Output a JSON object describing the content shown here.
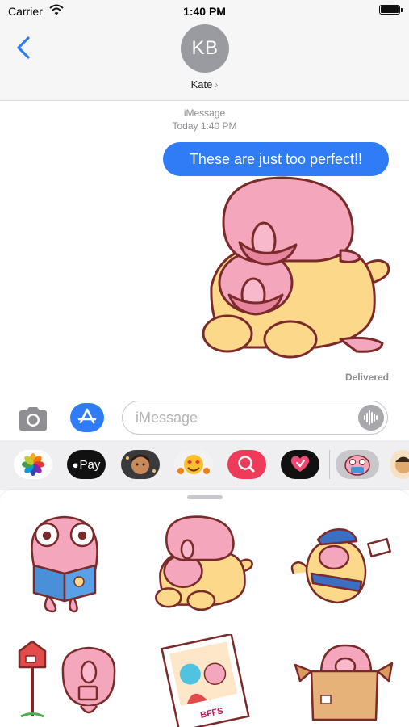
{
  "status_bar": {
    "carrier": "Carrier",
    "time": "1:40 PM"
  },
  "header": {
    "avatar_initials": "KB",
    "contact_name": "Kate",
    "chevron": "›"
  },
  "conversation": {
    "service": "iMessage",
    "timestamp": "Today 1:40 PM",
    "message": "These are just too perfect!!",
    "delivered": "Delivered",
    "sticker": "blobfish-on-cat-sticker"
  },
  "compose": {
    "placeholder": "iMessage"
  },
  "app_strip": [
    {
      "name": "photos-app-icon"
    },
    {
      "name": "apple-pay-app-icon",
      "label": "Pay"
    },
    {
      "name": "memoji-app-icon"
    },
    {
      "name": "emoji-stickers-app-icon"
    },
    {
      "name": "search-images-app-icon"
    },
    {
      "name": "digital-touch-app-icon"
    },
    {
      "name": "blobfish-sticker-app-icon"
    },
    {
      "name": "avatar-app-icon"
    }
  ],
  "stickers": [
    "blobfish-reading-book-sticker",
    "blobfish-on-cat-sticker",
    "blobfish-mail-carrier-sticker",
    "blobfish-mailbox-sticker",
    "bffs-photo-sticker",
    "blobfish-in-box-sticker"
  ],
  "sticker_texts": {
    "photo_caption": "BFFS"
  },
  "colors": {
    "accent": "#2f7cf6",
    "blob_pink": "#f4a6bd",
    "cat_yellow": "#fcd98a",
    "outline": "#7b2a2a"
  }
}
